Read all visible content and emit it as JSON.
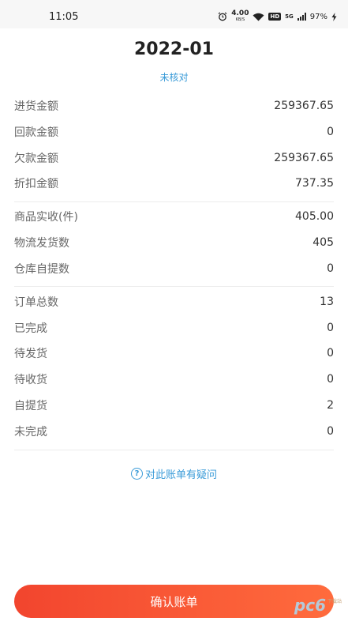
{
  "status_bar": {
    "time": "11:05",
    "speed_value": "4.00",
    "speed_unit": "KB/S",
    "hd": "HD",
    "network": "5G",
    "battery": "97%"
  },
  "header": {
    "title": "2022-01",
    "status": "未核对"
  },
  "sections": [
    [
      {
        "label": "进货金额",
        "value": "259367.65"
      },
      {
        "label": "回款金额",
        "value": "0"
      },
      {
        "label": "欠款金额",
        "value": "259367.65"
      },
      {
        "label": "折扣金额",
        "value": "737.35"
      }
    ],
    [
      {
        "label": "商品实收(件)",
        "value": "405.00"
      },
      {
        "label": "物流发货数",
        "value": "405"
      },
      {
        "label": "仓库自提数",
        "value": "0"
      }
    ],
    [
      {
        "label": "订单总数",
        "value": "13"
      },
      {
        "label": "已完成",
        "value": "0"
      },
      {
        "label": "待发货",
        "value": "0"
      },
      {
        "label": "待收货",
        "value": "0"
      },
      {
        "label": "自提货",
        "value": "2"
      },
      {
        "label": "未完成",
        "value": "0"
      }
    ]
  ],
  "question_link": "对此账单有疑问",
  "question_icon_glyph": "?",
  "confirm_button": "确认账单",
  "watermark": {
    "text": "pc6",
    "sub": "下载站"
  }
}
